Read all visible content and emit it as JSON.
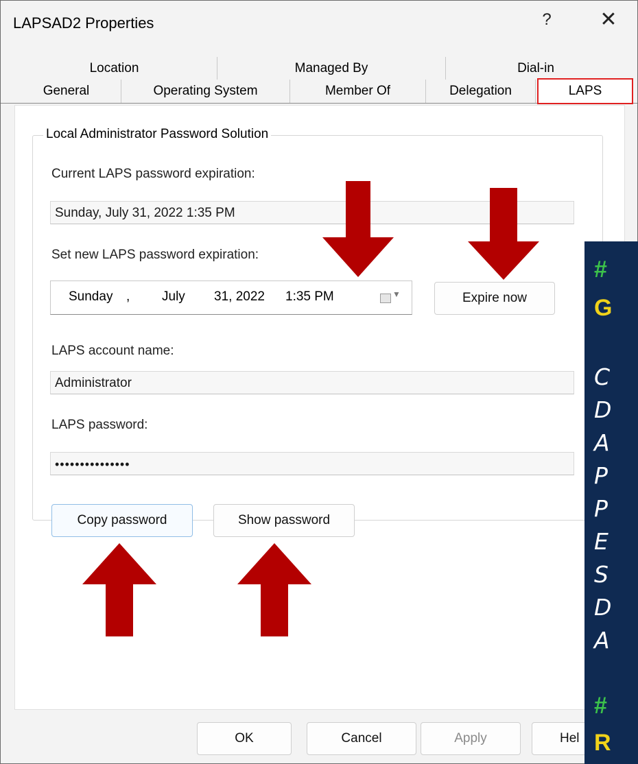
{
  "window": {
    "title": "LAPSAD2 Properties",
    "help_glyph": "?",
    "close_glyph": "✕"
  },
  "tabs_row1": [
    "Location",
    "Managed By",
    "Dial-in"
  ],
  "tabs_row2": [
    "General",
    "Operating System",
    "Member Of",
    "Delegation",
    "LAPS"
  ],
  "active_tab": "LAPS",
  "group": {
    "legend": "Local Administrator Password Solution",
    "current_exp_label": "Current LAPS password expiration:",
    "current_exp_value": "Sunday, July 31, 2022 1:35 PM",
    "new_exp_label": "Set new LAPS password expiration:",
    "new_exp": {
      "day": "Sunday",
      "sep": ",",
      "month": "July",
      "date_year": "31, 2022",
      "time": "1:35 PM"
    },
    "expire_now": "Expire now",
    "account_label": "LAPS account name:",
    "account_value": "Administrator",
    "password_label": "LAPS password:",
    "password_value": "•••••••••••••••",
    "copy_password": "Copy password",
    "show_password": "Show password"
  },
  "footer": {
    "ok": "OK",
    "cancel": "Cancel",
    "apply": "Apply",
    "help": "Hel"
  },
  "overlay": {
    "lines": [
      {
        "kind": "hash",
        "text": "#"
      },
      {
        "kind": "yellow",
        "text": "G"
      },
      {
        "kind": "white",
        "text": "C"
      },
      {
        "kind": "white",
        "text": "D"
      },
      {
        "kind": "white",
        "text": "A"
      },
      {
        "kind": "white",
        "text": "P"
      },
      {
        "kind": "white",
        "text": "P"
      },
      {
        "kind": "white",
        "text": "E"
      },
      {
        "kind": "white",
        "text": "S"
      },
      {
        "kind": "white",
        "text": "D"
      },
      {
        "kind": "white",
        "text": "A"
      },
      {
        "kind": "hash",
        "text": "#"
      },
      {
        "kind": "yellow",
        "text": "R"
      }
    ]
  },
  "colors": {
    "arrow": "#b30000",
    "highlight": "#e02020",
    "overlay_bg": "#0f2a52"
  }
}
